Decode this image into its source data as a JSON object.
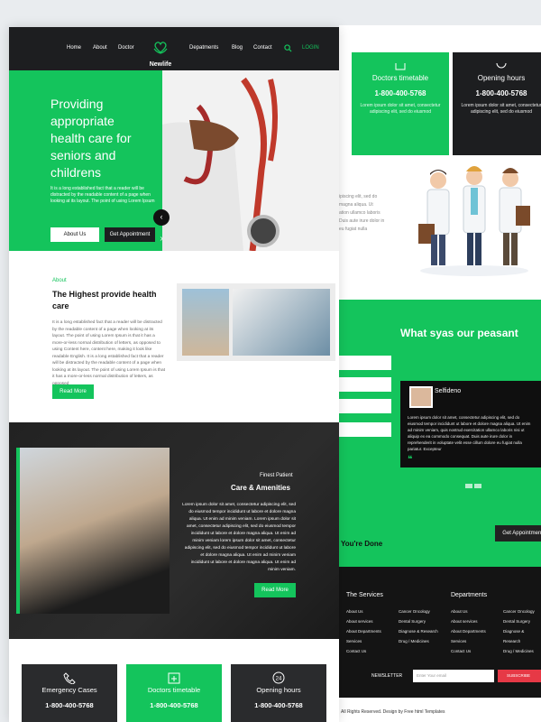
{
  "nav": {
    "links": [
      "Home",
      "About",
      "Doctor",
      "Depatments",
      "Blog",
      "Contact"
    ],
    "brand": "Newlife",
    "login": "LOGIN"
  },
  "hero": {
    "heading": "Providing appropriate health care for seniors and childrens",
    "body": "It is a long established fact that a reader will be distracted by the readable content of a page when looking at its layout. The point of using Lorem Ipsum",
    "btn_about": "About Us",
    "btn_appointment": "Get Appointment"
  },
  "about": {
    "kicker": "About",
    "heading": "The Highest provide health care",
    "body": "It is a long established fact that a reader will be distracted by the readable content of a page when looking at its layout. The point of using Lorem Ipsum is that it has a more-or-less normal distribution of letters, as opposed to using Content here, content here, making it look like readable English. It is a long established fact that a reader will be distracted by the readable content of a page when looking at its layout. The point of using Lorem Ipsum is that it has a more-or-less normal distribution of letters, as opposed",
    "btn": "Read More"
  },
  "care": {
    "kicker": "Finest Patient",
    "heading": "Care & Amenities",
    "body": "Lorem ipsum dolor sit amet, consectetur adipiscing elit, sed do eiusmod tempor incididunt ut labore et dolore magna aliqua. Ut enim ad minim veniam. Lorem ipsum dolor sit amet, consectetur adipiscing elit, sed do eiusmod tempor incididunt ut labore et dolore magna aliqua. Ut enim ad minim veniam lorem ipsum dolor sit amet, consectetur adipiscing elit, sed do eiusmod tempor incididunt ut labore et dolore magna aliqua. Ut enim ad minim veniam incididunt ut labore et dolore magna aliqua. Ut enim ad minim veniam.",
    "btn": "Read More"
  },
  "cards": [
    {
      "title": "Emergency Cases",
      "phone": "1-800-400-5768"
    },
    {
      "title": "Doctors timetable",
      "phone": "1-800-400-5768"
    },
    {
      "title": "Opening hours",
      "phone": "1-800-400-5768"
    }
  ],
  "back": {
    "cards": [
      {
        "title": "Doctors timetable",
        "phone": "1-800-400-5768",
        "desc": "Lorem ipsum dolor sit amet, consectetur adipiscing elit, sed do eiusmod"
      },
      {
        "title": "Opening hours",
        "phone": "1-800-400-5768",
        "desc": "Lorem ipsum dolor sit amet, consectetur adipiscing elit, sed do eiusmod"
      }
    ],
    "partial_text": [
      "ipiscing elit, sed do",
      "magna aliqua. Ut",
      "ation ullamco laboris",
      "Duis aute irure dolor in",
      "eu fugiat nulla"
    ],
    "testimonial_heading": "What syas our peasant",
    "reviewer": "Selfideno",
    "review": "Lorem ipsum dolor sit amet, consectetur adipiscing elit, sed do eiusmod tempor incididunt ut labore et dolore magna aliqua. Ut enim ad minim veniam, quis nostrud exercitation ullamco laboris nisi ut aliquip ex ea commodo consequat. Duis aute irure dolor in reprehenderit in voluptate velit esse cillum dolore eu fugiat nulla pariatur. Excepteur",
    "cta_text": "You're Done",
    "cta_btn": "Get Appointment",
    "footer": {
      "services_heading": "The Services",
      "departments_heading": "Departments",
      "col1": [
        "About Us",
        "About services",
        "About Departments",
        "Services",
        "Contact Us"
      ],
      "col2": [
        "Cancer Oncology",
        "Dental Surgery",
        "Diagnose & Research",
        "Drug / Medicines"
      ],
      "col3": [
        "About Us",
        "About services",
        "About Departments",
        "Services",
        "Contact Us"
      ],
      "col4": [
        "Cancer Oncology",
        "Dental Surgery",
        "Diagnose & Research",
        "Drug / Medicines"
      ],
      "newsletter": "NEWSLETTER",
      "email_placeholder": "Enter Your email",
      "subscribe": "SUBSCRIBE"
    },
    "copyright": "All Rights Reserved. Design by Free html Templates"
  }
}
